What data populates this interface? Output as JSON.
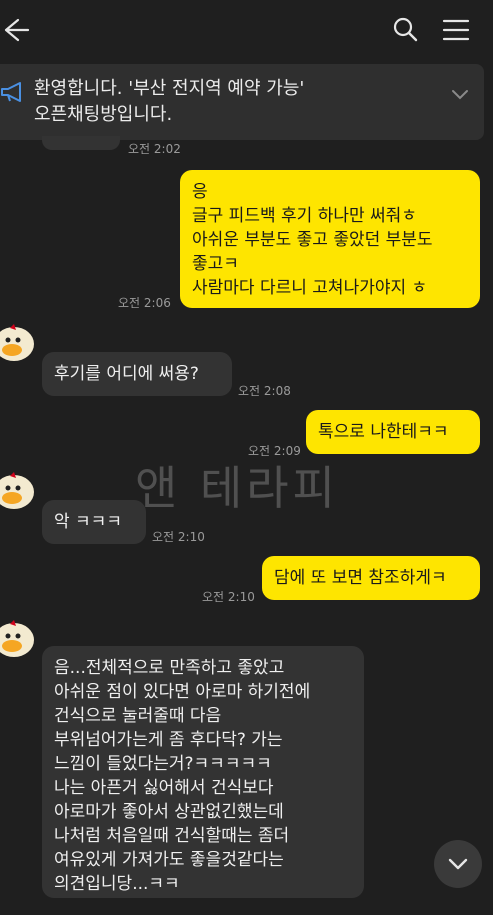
{
  "notice": {
    "text": "환영합니다. '부산 전지역 예약 가능'\n오픈채팅방입니다."
  },
  "watermark": "앤 테라피",
  "messages": [
    {
      "time": "오전 2:02"
    },
    {
      "text": "응\n글구 피드백 후기 하나만 써줘ㅎ\n아쉬운 부분도 좋고 좋았던 부분도\n좋고ㅋ\n사람마다 다르니 고쳐나가야지 ㅎ",
      "time": "오전 2:06"
    },
    {
      "text": "후기를 어디에 써용?",
      "time": "오전 2:08"
    },
    {
      "text": "톡으로 나한테ㅋㅋ",
      "time": "오전 2:09"
    },
    {
      "text": "악 ㅋㅋㅋ",
      "time": "오전 2:10"
    },
    {
      "text": "담에 또 보면 참조하게ㅋ",
      "time": "오전 2:10"
    },
    {
      "text": "음...전체적으로 만족하고 좋았고\n아쉬운 점이 있다면 아로마 하기전에\n건식으로 눌러줄때 다음\n부위넘어가는게 좀 후다닥? 가는\n느낌이 들었다는거?ㅋㅋㅋㅋㅋ\n나는 아픈거 싫어해서 건식보다\n아로마가 좋아서 상관없긴했는데\n나처럼 처음일때 건식할때는 좀더\n여유있게 가져가도 좋을것같다는\n의견입니당...ㅋㅋ"
    }
  ],
  "colors": {
    "background": "#1f1f1f",
    "my_bubble": "#fee500",
    "other_bubble": "#333333"
  },
  "icons": [
    "back-arrow-icon",
    "search-icon",
    "menu-icon",
    "megaphone-icon",
    "chevron-down-icon",
    "avatar-icon",
    "scroll-down-icon"
  ]
}
